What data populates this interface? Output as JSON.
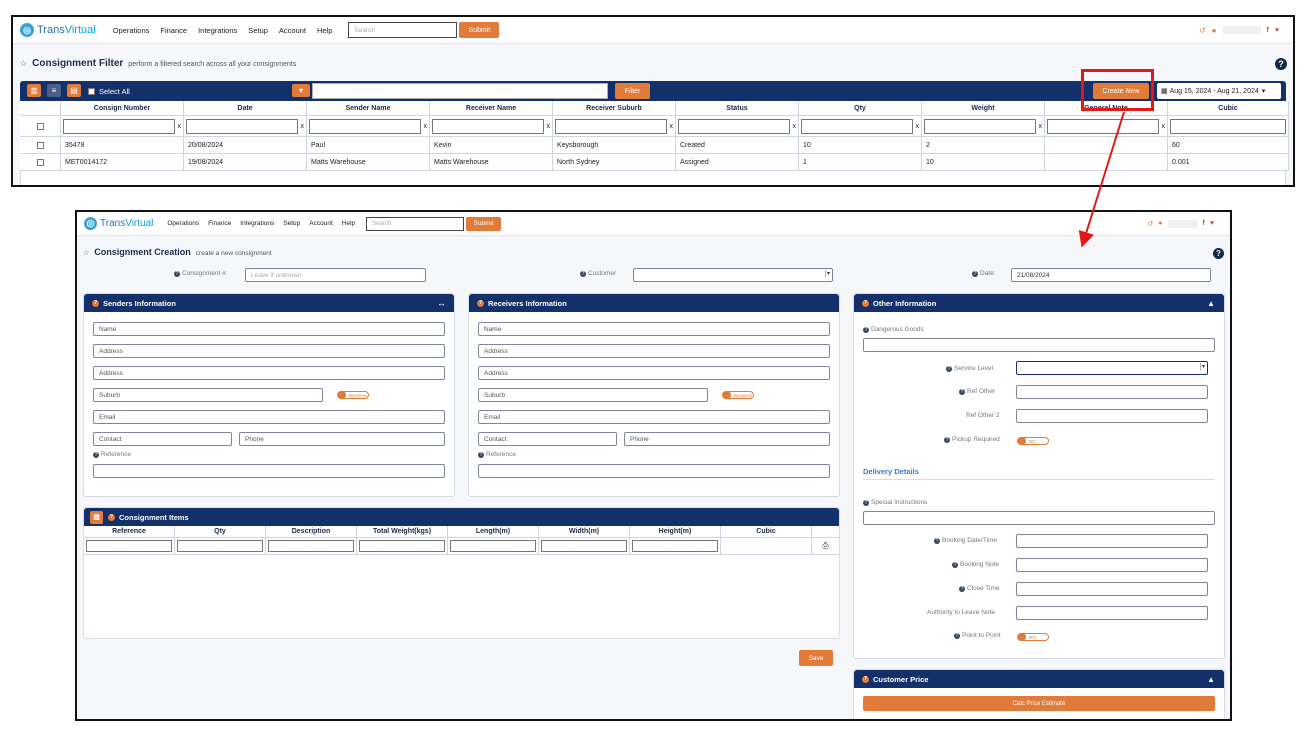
{
  "app": {
    "logo_trans": "Trans",
    "logo_virtual": "Virtual",
    "menu": [
      "Operations",
      "Finance",
      "Integrations",
      "Setup",
      "Account",
      "Help"
    ],
    "search_placeholder": "Search",
    "submit_label": "Submit"
  },
  "filter_page": {
    "title": "Consignment Filter",
    "subtitle": "perform a filtered search across all your consignments",
    "select_all_label": "Select All",
    "filter_button": "Filter",
    "create_new_button": "Create New",
    "date_range": "Aug 15, 2024 - Aug 21, 2024",
    "columns": [
      "Consign Number",
      "Date",
      "Sender Name",
      "Receiver Name",
      "Receiver Suburb",
      "Status",
      "Qty",
      "Weight",
      "General Note",
      "Cubic"
    ],
    "rows": [
      [
        "35478",
        "20/08/2024",
        "Paul",
        "Kevin",
        "Keysborough",
        "Created",
        "10",
        "2",
        "",
        "60"
      ],
      [
        "MET0014172",
        "19/08/2024",
        "Matts Warehouse",
        "Matts Warehouse",
        "North Sydney",
        "Assigned",
        "1",
        "10",
        "",
        "0.001"
      ]
    ]
  },
  "creation_page": {
    "title": "Consignment Creation",
    "subtitle": "create a new consignment",
    "consignment_label": "Consignment #:",
    "consignment_placeholder": "Leave if unknown",
    "customer_label": "Customer",
    "date_label": "Date:",
    "date_value": "21/08/2024",
    "senders": {
      "title": "Senders Information",
      "name": "Name",
      "address1": "Address",
      "address2": "Address",
      "suburb": "Suburb",
      "business_toggle": "Business",
      "email": "Email",
      "contact": "Contact",
      "phone": "Phone",
      "reference": "Reference"
    },
    "receivers": {
      "title": "Receivers Information",
      "name": "Name",
      "address1": "Address",
      "address2": "Address",
      "suburb": "Suburb",
      "business_toggle": "Business",
      "email": "Email",
      "contact": "Contact",
      "phone": "Phone",
      "reference": "Reference"
    },
    "other": {
      "title": "Other Information",
      "dangerous_goods": "Dangerous Goods",
      "service_level": "Service Level",
      "ref_other": "Ref Other",
      "ref_other_2": "Ref Other 2",
      "pickup_required": "Pickup Required",
      "pickup_toggle": "NO",
      "delivery_details": "Delivery Details",
      "special_instructions": "Special Instructions",
      "booking_datetime": "Booking Date/Time",
      "booking_note": "Booking Note",
      "close_time": "Close Time",
      "authority_to_leave": "Authority to Leave Note",
      "point_to_point": "Point to Point",
      "point_toggle": "NO"
    },
    "items": {
      "title": "Consignment Items",
      "columns": [
        "Reference",
        "Qty",
        "Description",
        "Total Weight(kgs)",
        "Length(m)",
        "Width(m)",
        "Height(m)",
        "Cubic"
      ]
    },
    "save_button": "Save",
    "customer_price": {
      "title": "Customer Price",
      "calc_button": "Calc Price Estimate"
    }
  }
}
